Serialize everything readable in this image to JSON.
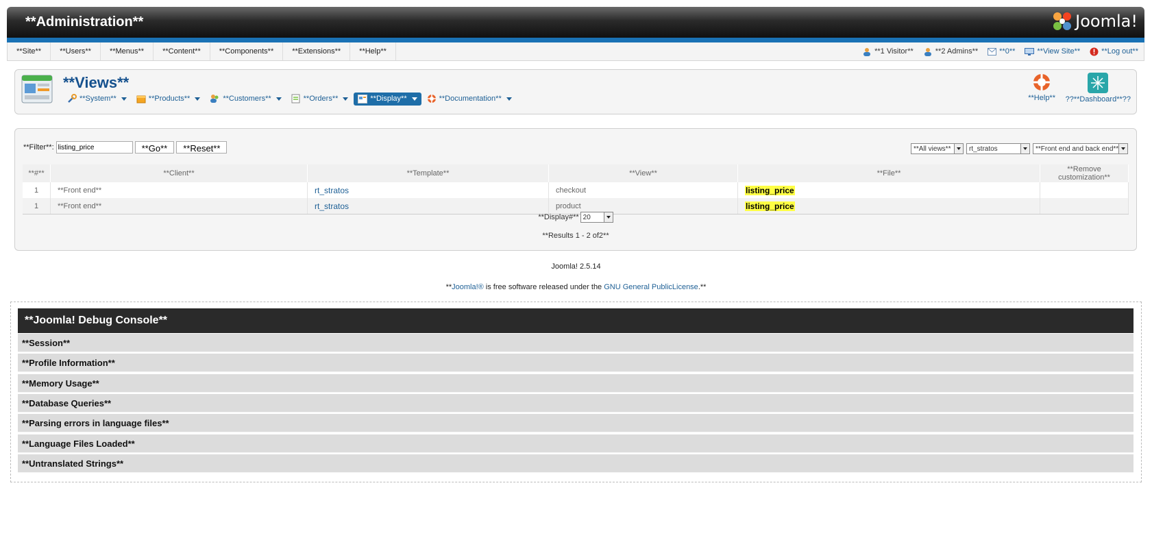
{
  "header": {
    "title": "**Administration**",
    "logo_text": "Joomla!"
  },
  "menu": {
    "items": [
      "**Site**",
      "**Users**",
      "**Menus**",
      "**Content**",
      "**Components**",
      "**Extensions**",
      "**Help**"
    ],
    "status": {
      "visitors": "**1 Visitor**",
      "admins": "**2 Admins**",
      "messages": "**0**",
      "view_site": "**View Site**",
      "logout": "**Log out**"
    }
  },
  "page": {
    "title": "**Views**",
    "submenu": [
      {
        "label": "**System**",
        "icon": "tools-icon"
      },
      {
        "label": "**Products**",
        "icon": "box-icon"
      },
      {
        "label": "**Customers**",
        "icon": "users-icon"
      },
      {
        "label": "**Orders**",
        "icon": "orders-icon"
      },
      {
        "label": "**Display**",
        "icon": "display-icon",
        "active": true
      },
      {
        "label": "**Documentation**",
        "icon": "lifebuoy-icon"
      }
    ],
    "toolbar": {
      "help": "**Help**",
      "dashboard": "??**Dashboard**??"
    }
  },
  "filter": {
    "label": "**Filter**:",
    "value": "listing_price",
    "go": "**Go**",
    "reset": "**Reset**",
    "views_select": "**All views**",
    "template_select": "rt_stratos",
    "scope_select": "**Front end and back end**"
  },
  "table": {
    "headers": [
      "**#**",
      "**Client**",
      "**Template**",
      "**View**",
      "**File**",
      "**Remove customization**"
    ],
    "rows": [
      {
        "num": "1",
        "client": "**Front end**",
        "template": "rt_stratos",
        "view": "checkout",
        "file": "listing_price"
      },
      {
        "num": "1",
        "client": "**Front end**",
        "template": "rt_stratos",
        "view": "product",
        "file": "listing_price"
      }
    ]
  },
  "pagination": {
    "display_label": "**Display#**",
    "display_value": "20",
    "results": "**Results 1 - 2 of2**"
  },
  "footer": {
    "version": "Joomla! 2.5.14",
    "prefix": "**",
    "joomla_link": "Joomla!®",
    "mid": " is free software released under the ",
    "gnu_link": "GNU General PublicLicense",
    "suffix": ".**"
  },
  "debug": {
    "title": "**Joomla! Debug Console**",
    "sections": [
      "**Session**",
      "**Profile Information**",
      "**Memory Usage**",
      "**Database Queries**",
      "**Parsing errors in language files**",
      "**Language Files Loaded**",
      "**Untranslated Strings**"
    ]
  },
  "colors": {
    "accent": "#1a72b5",
    "link": "#1d5f95",
    "highlight": "#ffff44",
    "debug_header": "#2a2a2a"
  }
}
